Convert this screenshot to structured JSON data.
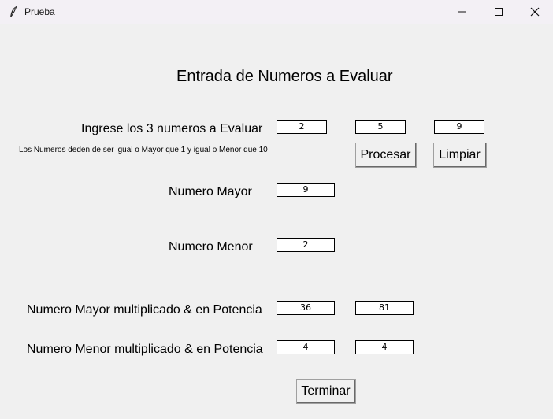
{
  "window": {
    "title": "Prueba"
  },
  "form": {
    "heading": "Entrada de Numeros a Evaluar",
    "input_label": "Ingrese los 3 numeros a Evaluar",
    "rule_text": "Los Numeros deden de ser igual o Mayor que 1 y igual o Menor que 10",
    "inputs": [
      "2",
      "5",
      "9"
    ],
    "process_label": "Procesar",
    "clear_label": "Limpiar",
    "max_label": "Numero Mayor",
    "max_value": "9",
    "min_label": "Numero Menor",
    "min_value": "2",
    "max_ops_label": "Numero Mayor multiplicado & en Potencia",
    "max_mult": "36",
    "max_pow": "81",
    "min_ops_label": "Numero Menor multiplicado & en Potencia",
    "min_mult": "4",
    "min_pow": "4",
    "finish_label": "Terminar"
  }
}
